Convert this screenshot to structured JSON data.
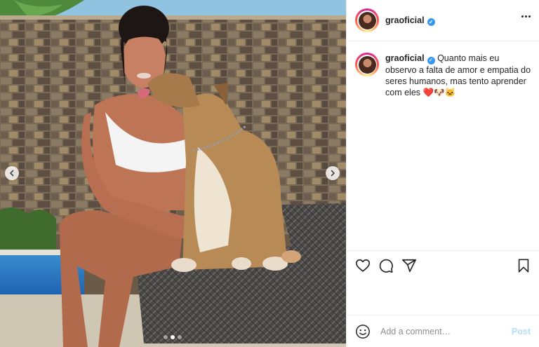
{
  "post": {
    "username": "graoficial",
    "verified": true,
    "caption_text": "Quanto mais eu observo a falta de amor e empatia do seres humanos, mas tento aprender com eles",
    "caption_emojis": "❤️🐶🐱",
    "carousel": {
      "slide_count": 3,
      "active_index": 1
    }
  },
  "header": {
    "username": "graoficial",
    "more_icon": "more-horizontal-icon"
  },
  "actions": {
    "like_icon": "heart-icon",
    "comment_icon": "comment-icon",
    "share_icon": "paper-plane-icon",
    "save_icon": "bookmark-icon"
  },
  "comment": {
    "placeholder": "Add a comment…",
    "post_label": "Post",
    "emoji_icon": "smiley-icon"
  },
  "colors": {
    "verified": "#3897f0",
    "post_disabled": "#b2dffc",
    "text": "#262626",
    "muted": "#8e8e8e"
  }
}
